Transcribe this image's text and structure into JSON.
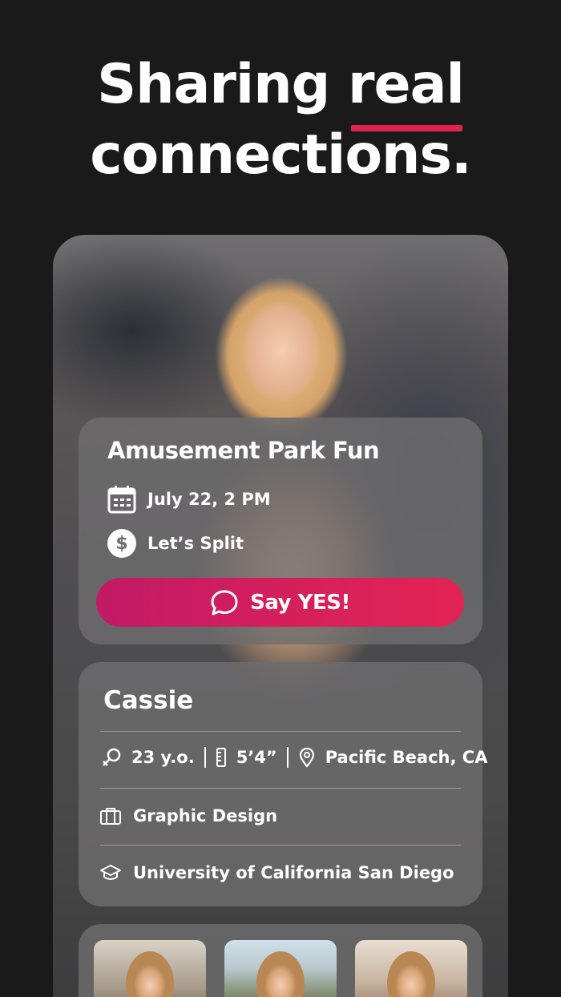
{
  "headline": {
    "line1_part1": "Sharing ",
    "line1_highlight": "real",
    "line2": "connections.",
    "accent_color": "#e0244f"
  },
  "event": {
    "title": "Amusement Park Fun",
    "date": "July 22, 2 PM",
    "payment": "Let’s Split",
    "cta_label": "Say YES!",
    "cta_color": "#d41f5c"
  },
  "profile": {
    "name": "Cassie",
    "age": "23 y.o.",
    "height": "5’4”",
    "location": "Pacific Beach, CA",
    "occupation": "Graphic Design",
    "education": "University of California San Diego"
  },
  "gallery": {
    "count_visible": 3
  }
}
